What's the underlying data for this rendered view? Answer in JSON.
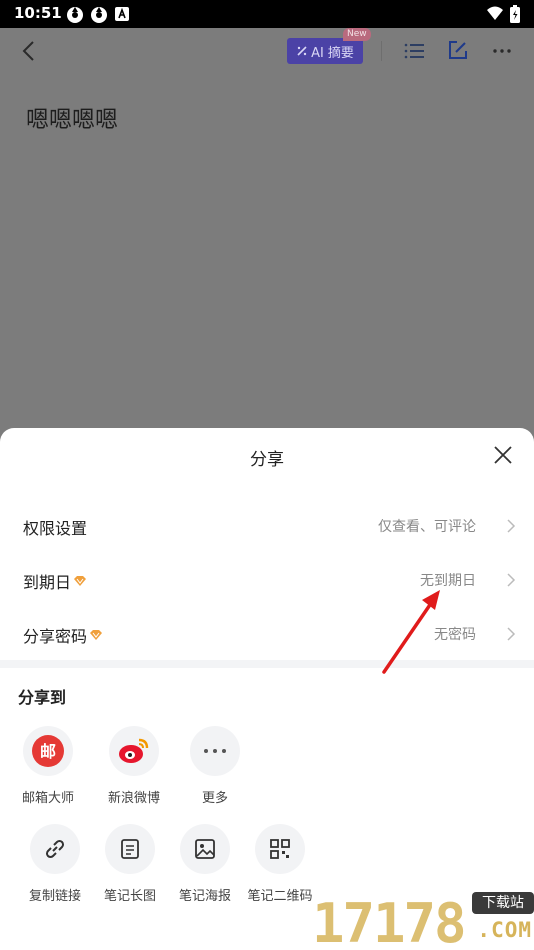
{
  "status_bar": {
    "time": "10:51"
  },
  "editor": {
    "ai_button": "AI 摘要",
    "new_badge": "New",
    "doc_title": "嗯嗯嗯嗯"
  },
  "share_sheet": {
    "title": "分享",
    "settings": [
      {
        "label": "权限设置",
        "value": "仅查看、可评论",
        "vip": false
      },
      {
        "label": "到期日",
        "value": "无到期日",
        "vip": true
      },
      {
        "label": "分享密码",
        "value": "无密码",
        "vip": true
      }
    ],
    "share_to_title": "分享到",
    "share_targets": [
      {
        "label": "邮箱大师",
        "icon": "mail-master-icon"
      },
      {
        "label": "新浪微博",
        "icon": "weibo-icon"
      },
      {
        "label": "更多",
        "icon": "more-dots-icon"
      },
      {
        "label": "复制链接",
        "icon": "link-icon"
      },
      {
        "label": "笔记长图",
        "icon": "long-image-icon"
      },
      {
        "label": "笔记海报",
        "icon": "poster-icon"
      },
      {
        "label": "笔记二维码",
        "icon": "qr-code-icon"
      }
    ]
  },
  "watermark": {
    "digits": "17178",
    "tag": "下载站",
    "domain": ".COM"
  },
  "colors": {
    "accent_vip": "#f0a03c",
    "ai_button": "#4b42a6",
    "weibo_red": "#e6162d",
    "mail_red": "#e53935"
  }
}
